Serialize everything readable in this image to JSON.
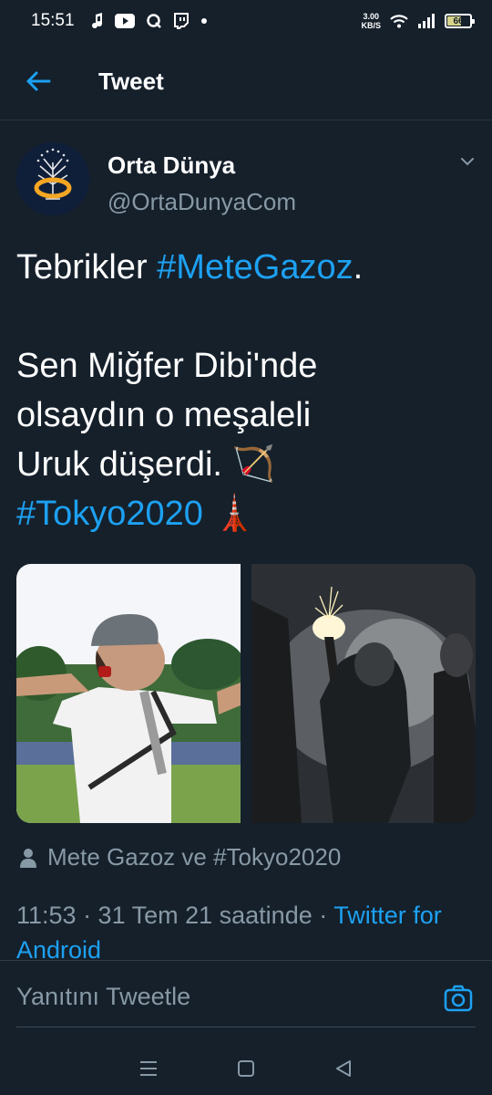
{
  "status_bar": {
    "time": "15:51",
    "net_speed_value": "3.00",
    "net_speed_unit": "KB/S",
    "battery": "66",
    "battery_level": 0.66,
    "icons": [
      "music-note-icon",
      "youtube-icon",
      "q-app-icon",
      "twitch-icon",
      "dot-icon",
      "wifi-icon",
      "signal-icon",
      "battery-icon"
    ]
  },
  "header": {
    "title": "Tweet"
  },
  "author": {
    "name": "Orta Dünya",
    "handle": "@OrtaDunyaCom"
  },
  "tweet": {
    "line1_prefix": "Tebrikler ",
    "line1_hashtag": "#MeteGazoz",
    "line1_suffix": ".",
    "line2": "Sen Miğfer Dibi'nde",
    "line3": "olsaydın o meşaleli",
    "line4": "Uruk düşerdi. 🏹",
    "line5_hashtag": "#Tokyo2020",
    "line5_emoji": "🗼"
  },
  "tagged": {
    "text": "Mete Gazoz ve #Tokyo2020"
  },
  "meta": {
    "timestamp": "11:53 · 31 Tem 21 saatinde · ",
    "source": "Twitter for Android"
  },
  "reply": {
    "placeholder": "Yanıtını Tweetle"
  },
  "colors": {
    "background": "#15202b",
    "accent": "#1da1f2",
    "secondary_text": "#8899a6"
  }
}
